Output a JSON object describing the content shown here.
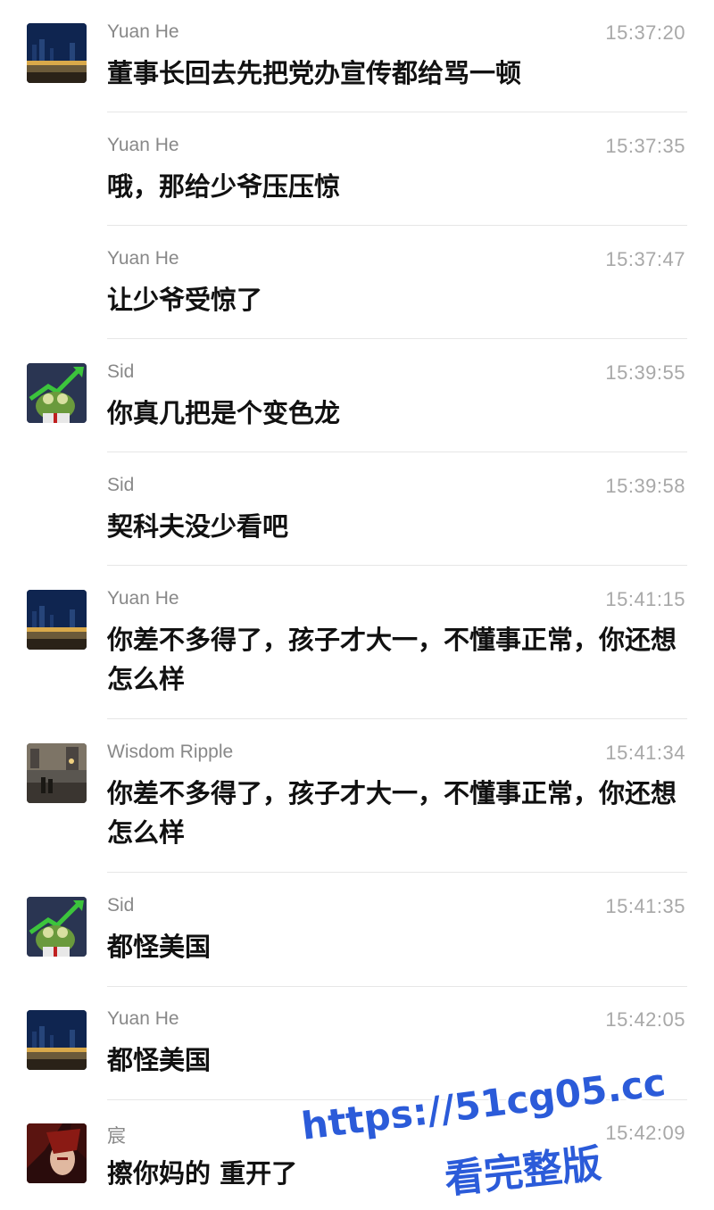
{
  "messages": [
    {
      "name": "Yuan He",
      "time": "15:37:20",
      "text": "董事长回去先把党办宣传都给骂一顿",
      "avatar": "city-night-avatar"
    },
    {
      "name": "Yuan He",
      "time": "15:37:35",
      "text": "哦，那给少爷压压惊",
      "avatar": ""
    },
    {
      "name": "Yuan He",
      "time": "15:37:47",
      "text": "让少爷受惊了",
      "avatar": ""
    },
    {
      "name": "Sid",
      "time": "15:39:55",
      "text": "你真几把是个变色龙",
      "avatar": "frog-stonks-avatar"
    },
    {
      "name": "Sid",
      "time": "15:39:58",
      "text": "契科夫没少看吧",
      "avatar": ""
    },
    {
      "name": "Yuan He",
      "time": "15:41:15",
      "text": "你差不多得了，孩子才大一，不懂事正常，你还想怎么样",
      "avatar": "city-night-avatar"
    },
    {
      "name": "Wisdom Ripple",
      "time": "15:41:34",
      "text": "你差不多得了，孩子才大一，不懂事正常，你还想怎么样",
      "avatar": "street-night-avatar"
    },
    {
      "name": "Sid",
      "time": "15:41:35",
      "text": "都怪美国",
      "avatar": "frog-stonks-avatar"
    },
    {
      "name": "Yuan He",
      "time": "15:42:05",
      "text": "都怪美国",
      "avatar": "city-night-avatar"
    },
    {
      "name": "宸",
      "time": "15:42:09",
      "text": "擦你妈的 重开了",
      "avatar": "anime-character-avatar"
    }
  ],
  "watermark": {
    "url": "https://51cg05.cc",
    "caption": "看完整版",
    "color": "#2b5bd9"
  }
}
